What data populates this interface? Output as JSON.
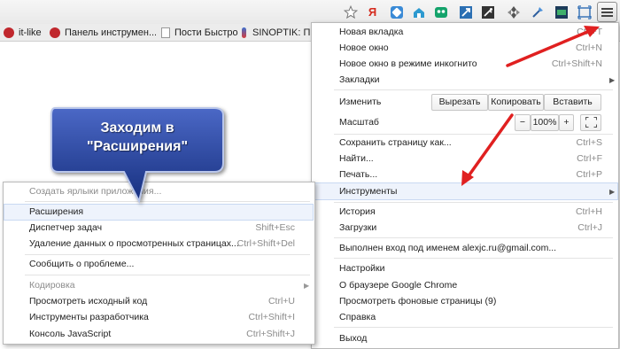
{
  "toolbar": {
    "icons": [
      "star-icon",
      "yandex-icon",
      "extension-icon",
      "home-icon",
      "extension-icon",
      "extension-icon",
      "extension-icon",
      "extension-icon",
      "extension-icon",
      "extension-icon",
      "window-icon",
      "menu-icon"
    ],
    "yandex_label": "Я",
    "menu_button_icon": "hamburger-menu-icon"
  },
  "bookmarks": [
    {
      "label": "it-like"
    },
    {
      "label": "Панель инструмен..."
    },
    {
      "label": "Пости Быстро"
    },
    {
      "label": "SINOPTIK: По"
    }
  ],
  "main_menu": {
    "items": {
      "new_tab": {
        "label": "Новая вкладка",
        "shortcut": "Ctrl+T"
      },
      "new_window": {
        "label": "Новое окно",
        "shortcut": "Ctrl+N"
      },
      "incognito": {
        "label": "Новое окно в режиме инкогнито",
        "shortcut": "Ctrl+Shift+N"
      },
      "bookmarks": {
        "label": "Закладки"
      },
      "edit": {
        "label": "Изменить",
        "cut": "Вырезать",
        "copy": "Копировать",
        "paste": "Вставить"
      },
      "zoom": {
        "label": "Масштаб",
        "minus": "−",
        "value": "100%",
        "plus": "+"
      },
      "save_page": {
        "label": "Сохранить страницу как...",
        "shortcut": "Ctrl+S"
      },
      "find": {
        "label": "Найти...",
        "shortcut": "Ctrl+F"
      },
      "print": {
        "label": "Печать...",
        "shortcut": "Ctrl+P"
      },
      "tools": {
        "label": "Инструменты"
      },
      "history": {
        "label": "История",
        "shortcut": "Ctrl+H"
      },
      "downloads": {
        "label": "Загрузки",
        "shortcut": "Ctrl+J"
      },
      "signed_in": {
        "label": "Выполнен вход под именем alexjc.ru@gmail.com..."
      },
      "settings": {
        "label": "Настройки"
      },
      "about": {
        "label": "О браузере Google Chrome"
      },
      "background_pages": {
        "label": "Просмотреть фоновые страницы (9)"
      },
      "help": {
        "label": "Справка"
      },
      "exit": {
        "label": "Выход"
      }
    }
  },
  "tools_submenu": {
    "items": {
      "create_shortcuts": {
        "label": "Создать ярлыки приложения..."
      },
      "extensions": {
        "label": "Расширения"
      },
      "task_manager": {
        "label": "Диспетчер задач",
        "shortcut": "Shift+Esc"
      },
      "clear_data": {
        "label": "Удаление данных о просмотренных страницах...",
        "shortcut": "Ctrl+Shift+Del"
      },
      "report_issue": {
        "label": "Сообщить о проблеме..."
      },
      "encoding": {
        "label": "Кодировка"
      },
      "view_source": {
        "label": "Просмотреть исходный код",
        "shortcut": "Ctrl+U"
      },
      "dev_tools": {
        "label": "Инструменты разработчика",
        "shortcut": "Ctrl+Shift+I"
      },
      "js_console": {
        "label": "Консоль JavaScript",
        "shortcut": "Ctrl+Shift+J"
      }
    }
  },
  "callout": {
    "line1": "Заходим в",
    "line2": "\"Расширения\""
  },
  "colors": {
    "callout_fill": "#1f3a93",
    "arrow": "#e02020",
    "hover_highlight": "#eef3fc"
  }
}
